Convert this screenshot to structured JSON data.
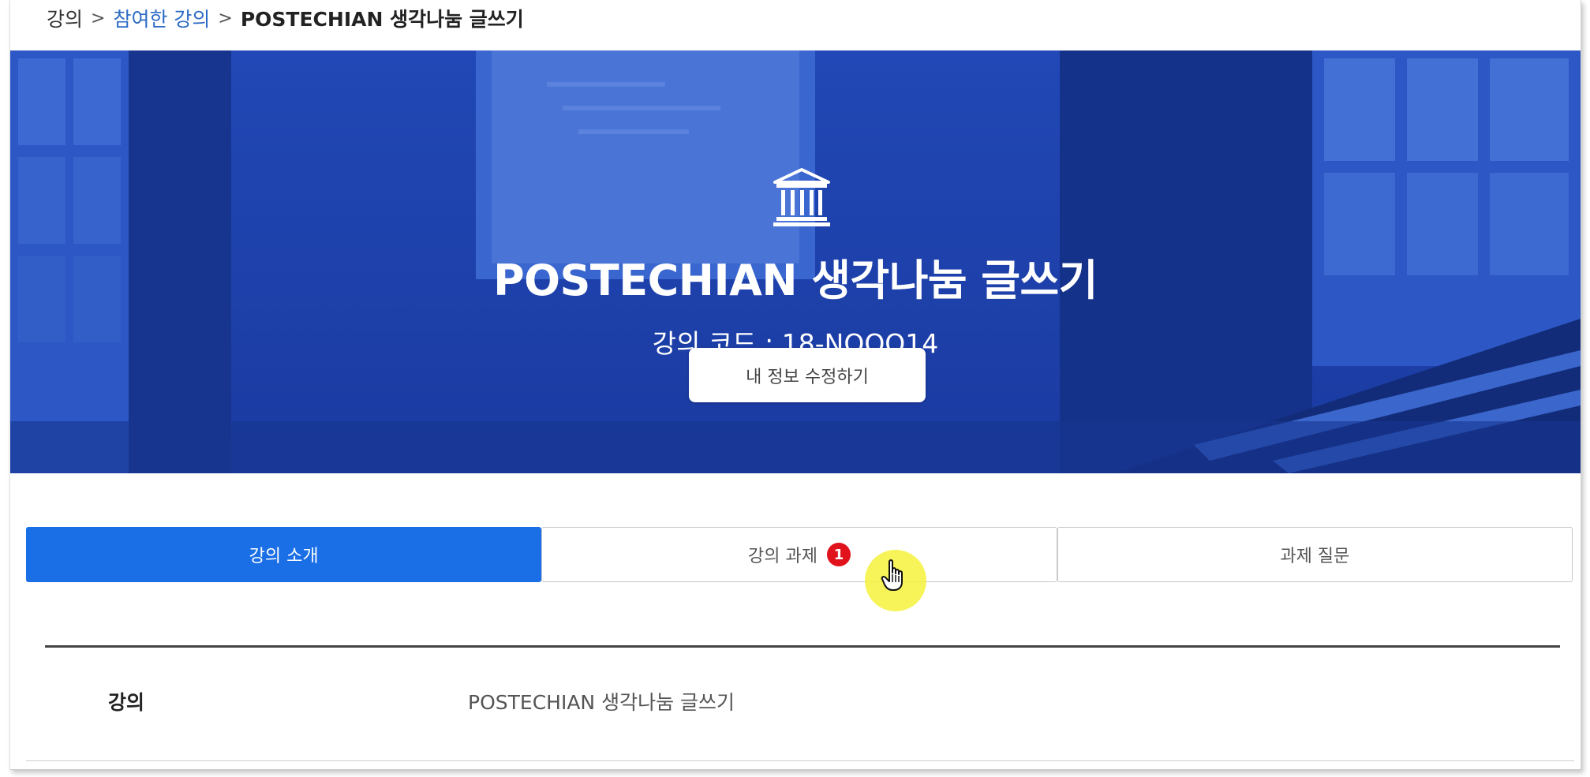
{
  "breadcrumb": {
    "root": "강의",
    "separator": ">",
    "parent": "참여한 강의",
    "current": "POSTECHIAN 생각나눔 글쓰기"
  },
  "hero": {
    "icon": "institution-icon",
    "title": "POSTECHIAN 생각나눔 글쓰기",
    "code_text": "강의 코드 : 18-NOQO14",
    "edit_button_label": "내 정보 수정하기",
    "background_color": "#1a3fa8"
  },
  "tabs": [
    {
      "label": "강의 소개",
      "active": true
    },
    {
      "label": "강의 과제",
      "active": false,
      "badge": "1"
    },
    {
      "label": "과제 질문",
      "active": false
    }
  ],
  "info": {
    "label": "강의",
    "value": "POSTECHIAN 생각나눔 글쓰기"
  },
  "colors": {
    "accent": "#1a6fe6",
    "badge": "#e0121b",
    "link": "#2d6bc4"
  }
}
